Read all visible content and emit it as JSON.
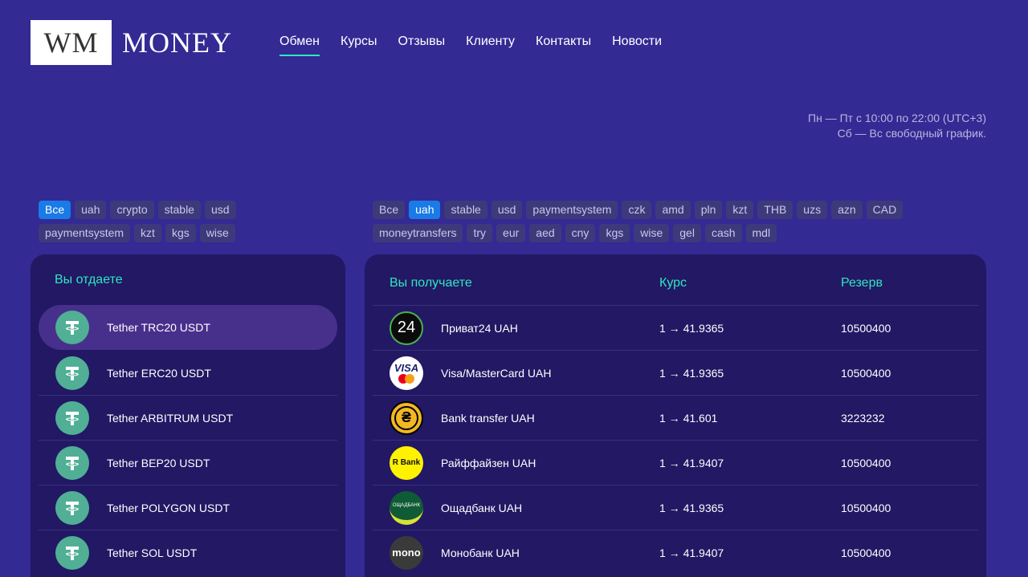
{
  "logo": {
    "box_text": "WM",
    "text": "MONEY"
  },
  "nav": [
    {
      "label": "Обмен",
      "active": true
    },
    {
      "label": "Курсы"
    },
    {
      "label": "Отзывы"
    },
    {
      "label": "Клиенту"
    },
    {
      "label": "Контакты"
    },
    {
      "label": "Новости"
    }
  ],
  "schedule": {
    "line1": "Пн — Пт с 10:00 по 22:00 (UTC+3)",
    "line2": "Сб — Вс свободный график."
  },
  "filters_give": [
    "Все",
    "uah",
    "crypto",
    "stable",
    "usd",
    "paymentsystem",
    "kzt",
    "kgs",
    "wise"
  ],
  "filters_give_active": 0,
  "filters_get": [
    "Все",
    "uah",
    "stable",
    "usd",
    "paymentsystem",
    "czk",
    "amd",
    "pln",
    "kzt",
    "THB",
    "uzs",
    "azn",
    "CAD",
    "moneytransfers",
    "try",
    "eur",
    "aed",
    "cny",
    "kgs",
    "wise",
    "gel",
    "cash",
    "mdl"
  ],
  "filters_get_active": 1,
  "give_panel": {
    "header": "Вы отдаете",
    "items": [
      {
        "label": "Tether TRC20 USDT",
        "icon": "tether-icon"
      },
      {
        "label": "Tether ERC20 USDT",
        "icon": "tether-icon"
      },
      {
        "label": "Tether ARBITRUM USDT",
        "icon": "tether-icon"
      },
      {
        "label": "Tether BEP20 USDT",
        "icon": "tether-icon"
      },
      {
        "label": "Tether POLYGON USDT",
        "icon": "tether-icon"
      },
      {
        "label": "Tether SOL USDT",
        "icon": "tether-icon"
      }
    ]
  },
  "get_panel": {
    "header_receive": "Вы получаете",
    "header_rate": "Курс",
    "header_reserve": "Резерв",
    "items": [
      {
        "label": "Приват24 UAH",
        "rate": "1 → 41.9365",
        "reserve": "10500400",
        "icon": "privat24-icon",
        "icon_text": "24"
      },
      {
        "label": "Visa/MasterCard UAH",
        "rate": "1 → 41.9365",
        "reserve": "10500400",
        "icon": "visa-mastercard-icon",
        "icon_text": "VISA"
      },
      {
        "label": "Bank transfer UAH",
        "rate": "1 → 41.601",
        "reserve": "3223232",
        "icon": "hryvnia-icon",
        "icon_text": "₴"
      },
      {
        "label": "Райффайзен UAH",
        "rate": "1 → 41.9407",
        "reserve": "10500400",
        "icon": "raiffeisen-icon",
        "icon_text": "R Bank"
      },
      {
        "label": "Ощадбанк UAH",
        "rate": "1 → 41.9365",
        "reserve": "10500400",
        "icon": "oschadbank-icon",
        "icon_text": "ОЩАДБАНК"
      },
      {
        "label": "Монобанк UAH",
        "rate": "1 → 41.9407",
        "reserve": "10500400",
        "icon": "monobank-icon",
        "icon_text": "mono"
      }
    ]
  },
  "colors": {
    "background": "#332a94",
    "panel": "#221864",
    "accent": "#2ee6c0",
    "chip_active": "#1a7ae6",
    "tether": "#50af95"
  }
}
